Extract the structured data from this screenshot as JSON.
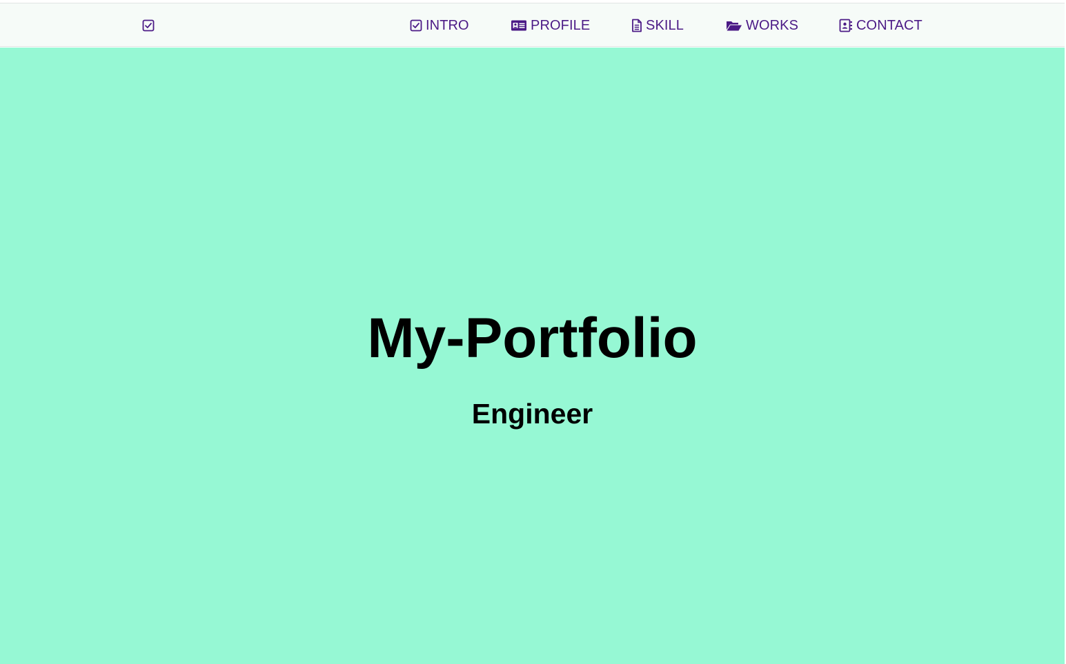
{
  "colors": {
    "nav_background": "#f6fbf8",
    "nav_link": "#4b1a86",
    "hero_background": "#96f8d4",
    "hero_text": "#000000"
  },
  "navbar": {
    "brand_icon": "check-square-icon",
    "items": [
      {
        "label": "INTRO",
        "icon": "check-square-icon"
      },
      {
        "label": "PROFILE",
        "icon": "id-card-icon"
      },
      {
        "label": "SKILL",
        "icon": "file-text-icon"
      },
      {
        "label": "WORKS",
        "icon": "folder-open-icon"
      },
      {
        "label": "CONTACT",
        "icon": "address-book-icon"
      }
    ]
  },
  "hero": {
    "title": "My-Portfolio",
    "subtitle": "Engineer"
  }
}
